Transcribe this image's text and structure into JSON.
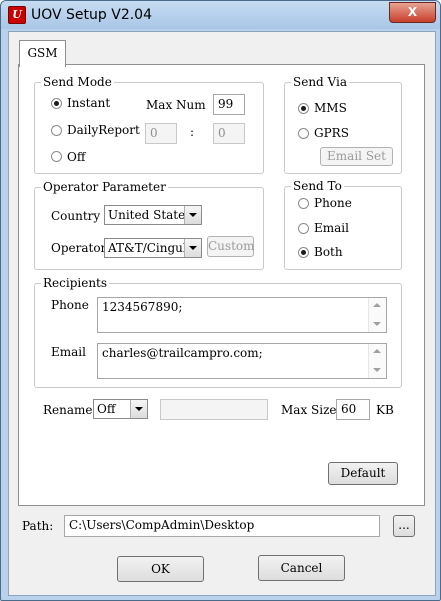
{
  "window": {
    "title": "UOV Setup V2.04",
    "icon_letter": "U",
    "close": "X"
  },
  "tabs": [
    "GSM"
  ],
  "send_mode": {
    "legend": "Send Mode",
    "options": [
      "Instant",
      "DailyReport",
      "Off"
    ],
    "selected": "Instant",
    "max_num_label": "Max Num",
    "max_num_value": "99",
    "time_hour": "0",
    "time_separator": ":",
    "time_minute": "0"
  },
  "send_via": {
    "legend": "Send Via",
    "options": [
      "MMS",
      "GPRS"
    ],
    "selected": "MMS",
    "email_set_label": "Email Set"
  },
  "operator": {
    "legend": "Operator Parameter",
    "country_label": "Country",
    "country_value": "United States",
    "operator_label": "Operator",
    "operator_value": "AT&T/Cingul",
    "custom_label": "Custom"
  },
  "send_to": {
    "legend": "Send To",
    "options": [
      "Phone",
      "Email",
      "Both"
    ],
    "selected": "Both"
  },
  "recipients": {
    "legend": "Recipients",
    "phone_label": "Phone",
    "phone_value": "1234567890;",
    "email_label": "Email",
    "email_value": "charles@trailcampro.com;"
  },
  "rename": {
    "label": "Rename",
    "value": "Off",
    "text": ""
  },
  "max_size": {
    "label": "Max Size",
    "value": "60",
    "unit": "KB"
  },
  "default_label": "Default",
  "path": {
    "label": "Path:",
    "value": "C:\\Users\\CompAdmin\\Desktop",
    "browse_label": "..."
  },
  "ok_label": "OK",
  "cancel_label": "Cancel"
}
